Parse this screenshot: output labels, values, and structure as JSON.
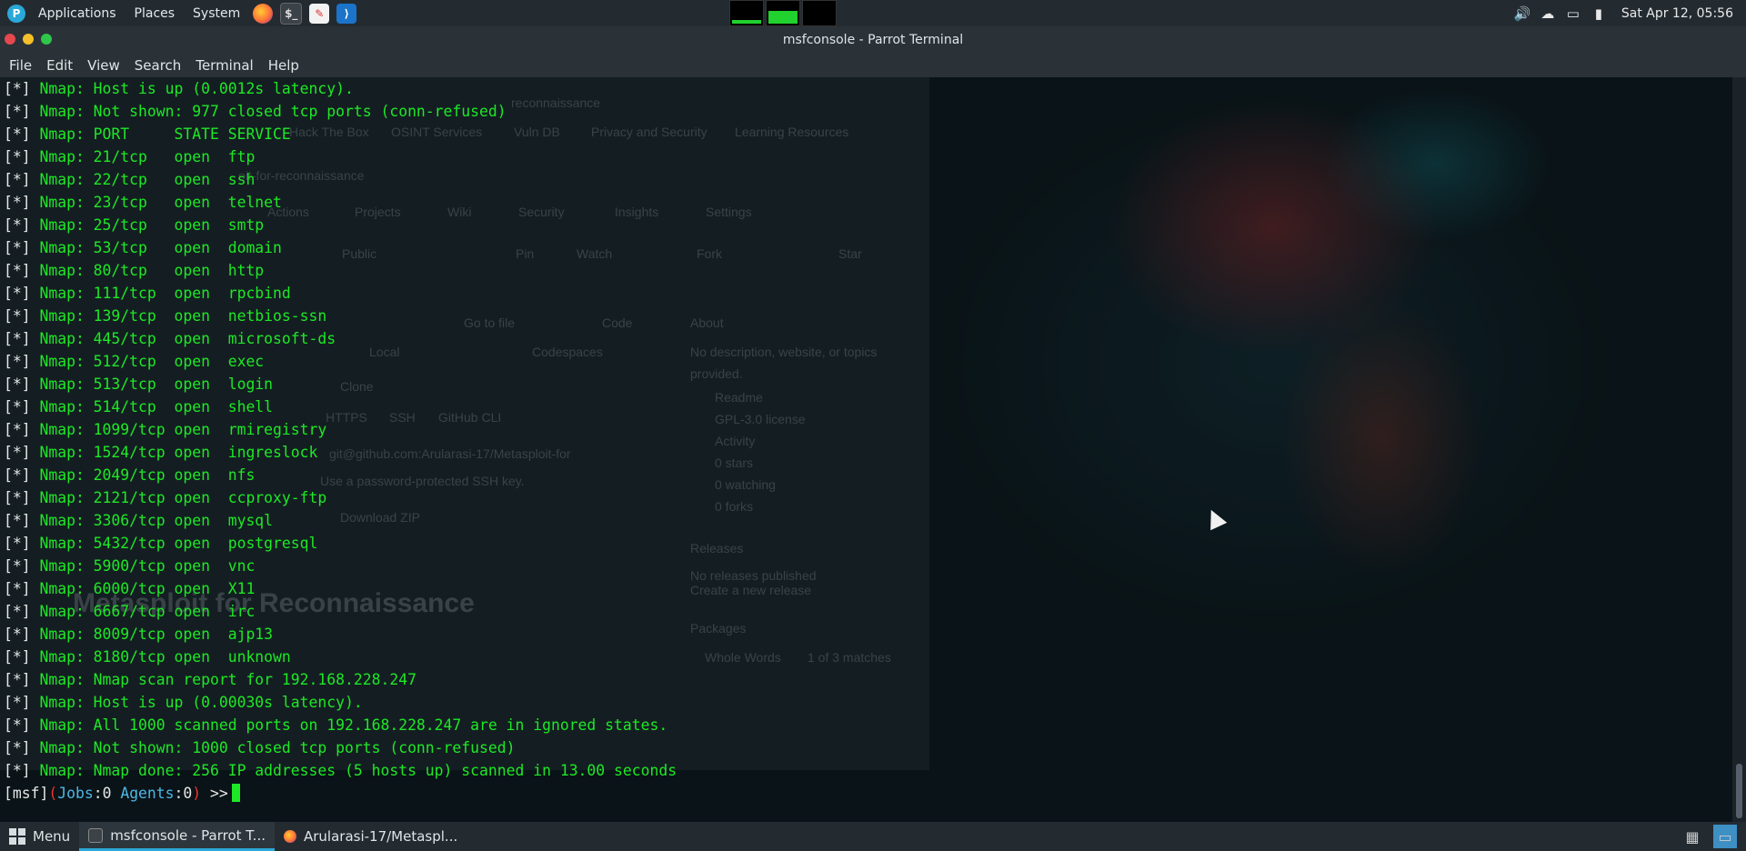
{
  "top_panel": {
    "menus": [
      "Applications",
      "Places",
      "System"
    ],
    "launchers": [
      "firefox-icon",
      "terminal-icon",
      "text-editor-icon",
      "vscode-icon"
    ],
    "tray_icons": [
      "volume-icon",
      "network-icon",
      "window-icon",
      "battery-icon"
    ],
    "clock": "Sat Apr 12, 05:56"
  },
  "window": {
    "title": "msfconsole - Parrot Terminal",
    "menu": [
      "File",
      "Edit",
      "View",
      "Search",
      "Terminal",
      "Help"
    ]
  },
  "terminal": {
    "lines": [
      {
        "tag": "[*]",
        "text": " Nmap: Host is up (0.0012s latency)."
      },
      {
        "tag": "[*]",
        "text": " Nmap: Not shown: 977 closed tcp ports (conn-refused)"
      },
      {
        "tag": "[*]",
        "text": " Nmap: PORT     STATE SERVICE"
      },
      {
        "tag": "[*]",
        "text": " Nmap: 21/tcp   open  ftp"
      },
      {
        "tag": "[*]",
        "text": " Nmap: 22/tcp   open  ssh"
      },
      {
        "tag": "[*]",
        "text": " Nmap: 23/tcp   open  telnet"
      },
      {
        "tag": "[*]",
        "text": " Nmap: 25/tcp   open  smtp"
      },
      {
        "tag": "[*]",
        "text": " Nmap: 53/tcp   open  domain"
      },
      {
        "tag": "[*]",
        "text": " Nmap: 80/tcp   open  http"
      },
      {
        "tag": "[*]",
        "text": " Nmap: 111/tcp  open  rpcbind"
      },
      {
        "tag": "[*]",
        "text": " Nmap: 139/tcp  open  netbios-ssn"
      },
      {
        "tag": "[*]",
        "text": " Nmap: 445/tcp  open  microsoft-ds"
      },
      {
        "tag": "[*]",
        "text": " Nmap: 512/tcp  open  exec"
      },
      {
        "tag": "[*]",
        "text": " Nmap: 513/tcp  open  login"
      },
      {
        "tag": "[*]",
        "text": " Nmap: 514/tcp  open  shell"
      },
      {
        "tag": "[*]",
        "text": " Nmap: 1099/tcp open  rmiregistry"
      },
      {
        "tag": "[*]",
        "text": " Nmap: 1524/tcp open  ingreslock"
      },
      {
        "tag": "[*]",
        "text": " Nmap: 2049/tcp open  nfs"
      },
      {
        "tag": "[*]",
        "text": " Nmap: 2121/tcp open  ccproxy-ftp"
      },
      {
        "tag": "[*]",
        "text": " Nmap: 3306/tcp open  mysql"
      },
      {
        "tag": "[*]",
        "text": " Nmap: 5432/tcp open  postgresql"
      },
      {
        "tag": "[*]",
        "text": " Nmap: 5900/tcp open  vnc"
      },
      {
        "tag": "[*]",
        "text": " Nmap: 6000/tcp open  X11"
      },
      {
        "tag": "[*]",
        "text": " Nmap: 6667/tcp open  irc"
      },
      {
        "tag": "[*]",
        "text": " Nmap: 8009/tcp open  ajp13"
      },
      {
        "tag": "[*]",
        "text": " Nmap: 8180/tcp open  unknown"
      },
      {
        "tag": "[*]",
        "text": " Nmap: Nmap scan report for 192.168.228.247"
      },
      {
        "tag": "[*]",
        "text": " Nmap: Host is up (0.00030s latency)."
      },
      {
        "tag": "[*]",
        "text": " Nmap: All 1000 scanned ports on 192.168.228.247 are in ignored states."
      },
      {
        "tag": "[*]",
        "text": " Nmap: Not shown: 1000 closed tcp ports (conn-refused)"
      },
      {
        "tag": "[*]",
        "text": " Nmap: Nmap done: 256 IP addresses (5 hosts up) scanned in 13.00 seconds"
      }
    ],
    "prompt": {
      "msf": "[msf]",
      "open": "(",
      "jobs_key": "Jobs",
      "jobs_val": ":0",
      "agents_key": " Agents",
      "agents_val": ":0",
      "close": ")",
      "arrow": " >>"
    }
  },
  "ghost_browser": {
    "texts": [
      "reconnaissance",
      "Hack The Box",
      "OSINT Services",
      "Vuln DB",
      "Privacy and Security",
      "Learning Resources",
      "oit-for-reconnaissance",
      "Actions",
      "Projects",
      "Wiki",
      "Security",
      "Insights",
      "Settings",
      "Public",
      "Pin",
      "Watch",
      "Fork",
      "Star",
      "Go to file",
      "Code",
      "About",
      "Local",
      "Codespaces",
      "No description, website, or topics",
      "provided.",
      "Clone",
      "Readme",
      "GPL-3.0 license",
      "Activity",
      "0 stars",
      "0 watching",
      "0 forks",
      "HTTPS",
      "SSH",
      "GitHub CLI",
      "git@github.com:Arularasi-17/Metasploit-for",
      "Use a password-protected SSH key.",
      "Download ZIP",
      "Releases",
      "No releases published",
      "Create a new release",
      "Packages",
      "Whole Words",
      "1 of 3 matches"
    ],
    "heading": "Metasploit for Reconnaissance"
  },
  "taskbar": {
    "menu_label": "Menu",
    "tasks": [
      {
        "label": "msfconsole - Parrot T...",
        "icon": "terminal-icon",
        "active": true
      },
      {
        "label": "Arularasi-17/Metaspl...",
        "icon": "firefox-icon",
        "active": false
      }
    ],
    "right_icons": [
      "workspace-icon",
      "terminal-workspace-icon"
    ]
  }
}
